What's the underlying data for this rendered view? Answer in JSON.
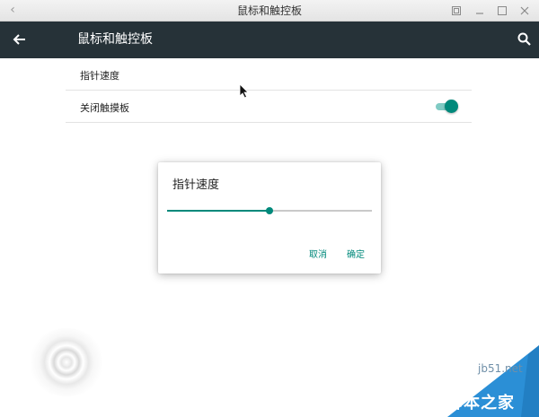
{
  "window": {
    "title": "鼠标和触控板",
    "back_icon": "chevron-left-icon",
    "controls": [
      "restore-icon",
      "minimize-icon",
      "maximize-icon",
      "close-icon"
    ]
  },
  "appbar": {
    "title": "鼠标和触控板",
    "back_icon": "arrow-back-icon",
    "search_icon": "search-icon",
    "background_color": "#263238"
  },
  "settings": {
    "items": [
      {
        "label": "指针速度"
      },
      {
        "label": "关闭触摸板",
        "toggle_on": true
      }
    ]
  },
  "dialog": {
    "title": "指针速度",
    "slider_value_percent": 50,
    "cancel_label": "取消",
    "ok_label": "确定",
    "accent_color": "#00897b"
  },
  "watermark": {
    "url": "jb51.net",
    "name": "脚本之家"
  }
}
